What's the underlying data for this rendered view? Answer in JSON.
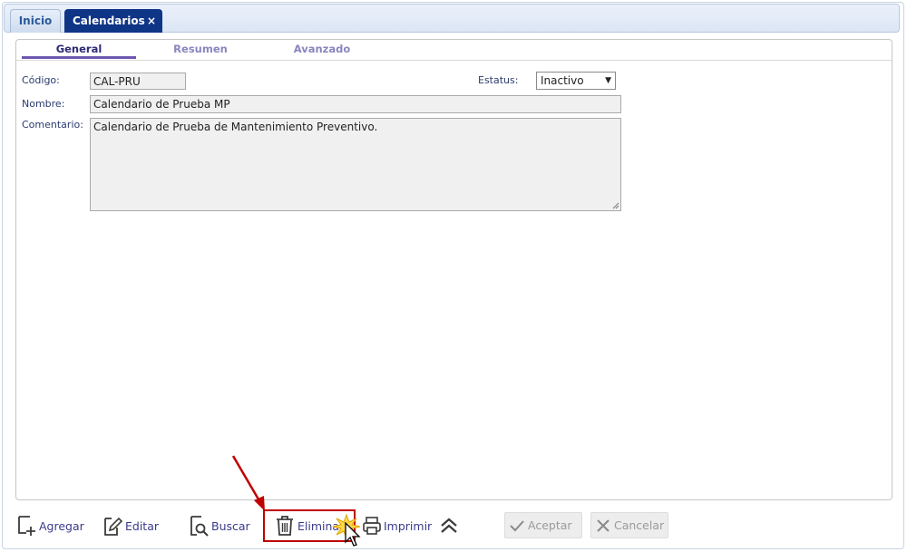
{
  "tabs": [
    {
      "label": "Inicio",
      "active": false
    },
    {
      "label": "Calendarios",
      "active": true,
      "close": "×"
    }
  ],
  "subtabs": [
    {
      "label": "General",
      "active": true
    },
    {
      "label": "Resumen",
      "active": false
    },
    {
      "label": "Avanzado",
      "active": false
    }
  ],
  "form": {
    "codigo_label": "Código:",
    "codigo_value": "CAL-PRU",
    "estatus_label": "Estatus:",
    "estatus_value": "Inactivo",
    "nombre_label": "Nombre:",
    "nombre_value": "Calendario de Prueba MP",
    "comentario_label": "Comentario:",
    "comentario_value": "Calendario de Prueba de Mantenimiento Preventivo."
  },
  "toolbar": {
    "agregar": "Agregar",
    "editar": "Editar",
    "buscar": "Buscar",
    "eliminar": "Eliminar",
    "imprimir": "Imprimir",
    "aceptar": "Aceptar",
    "cancelar": "Cancelar"
  },
  "icons": {
    "agregar": "add-document-icon",
    "editar": "edit-document-icon",
    "buscar": "search-document-icon",
    "eliminar": "trash-icon",
    "imprimir": "printer-icon",
    "collapse": "double-chevron-up-icon",
    "aceptar": "checkmark-icon",
    "cancelar": "x-icon"
  },
  "colors": {
    "active_tab": "#0f3586",
    "subtab_active_underline": "#6d57b0",
    "annotation": "#c00000"
  }
}
